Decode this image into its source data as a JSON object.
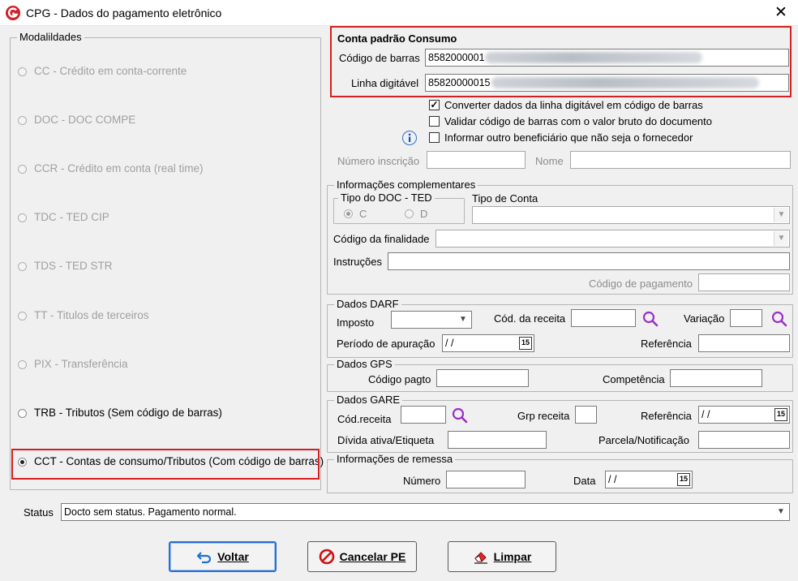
{
  "window": {
    "title": "CPG - Dados do pagamento eletrônico",
    "close_glyph": "✕",
    "logo_icon": "cpg-logo-icon"
  },
  "modalidades": {
    "legend": "Modalildades",
    "items": [
      {
        "label": "CC  - Crédito em conta-corrente",
        "enabled": false,
        "selected": false
      },
      {
        "label": "DOC - DOC COMPE",
        "enabled": false,
        "selected": false
      },
      {
        "label": "CCR - Crédito em conta (real time)",
        "enabled": false,
        "selected": false
      },
      {
        "label": "TDC - TED CIP",
        "enabled": false,
        "selected": false
      },
      {
        "label": "TDS - TED STR",
        "enabled": false,
        "selected": false
      },
      {
        "label": "TT  - Titulos de terceiros",
        "enabled": false,
        "selected": false
      },
      {
        "label": "PIX - Transferência",
        "enabled": false,
        "selected": false
      },
      {
        "label": "TRB - Tributos (Sem código de barras)",
        "enabled": true,
        "selected": false
      },
      {
        "label": "CCT - Contas de consumo/Tributos (Com código de barras)",
        "enabled": true,
        "selected": true
      }
    ]
  },
  "conta_padrao": {
    "legend": "Conta padrão Consumo",
    "codigo_barras_label": "Código de barras",
    "codigo_barras_value": "8582000001",
    "linha_digitavel_label": "Linha digitável",
    "linha_digitavel_value": "85820000015"
  },
  "options": {
    "converter": {
      "label": "Converter dados da linha digitável em código de barras",
      "checked": true
    },
    "validar": {
      "label": "Validar código de barras com o valor bruto do documento",
      "checked": false
    },
    "informar": {
      "label": "Informar outro beneficiário que não seja o fornecedor",
      "checked": false
    },
    "check_glyph": "✓",
    "info_icon": "info-icon"
  },
  "beneficiario": {
    "numero_inscricao_label": "Número inscrição",
    "nome_label": "Nome"
  },
  "info_compl": {
    "legend": "Informações complementares",
    "tipo_doc_legend": "Tipo do DOC - TED",
    "tipo_c": "C",
    "tipo_d": "D",
    "tipo_conta_label": "Tipo de Conta",
    "finalidade_label": "Código da finalidade",
    "instrucoes_label": "Instruções",
    "codigo_pagamento_label": "Código de pagamento"
  },
  "darf": {
    "legend": "Dados DARF",
    "imposto_label": "Imposto",
    "cod_receita_label": "Cód. da receita",
    "variacao_label": "Variação",
    "periodo_label": "Período de apuração",
    "periodo_value": " /  /",
    "referencia_label": "Referência"
  },
  "gps": {
    "legend": "Dados GPS",
    "codigo_label": "Código pagto",
    "competencia_label": "Competência"
  },
  "gare": {
    "legend": "Dados GARE",
    "cod_receita_label": "Cód.receita",
    "grp_receita_label": "Grp receita",
    "referencia_label": "Referência",
    "referencia_value": " /  /",
    "divida_label": "Dívida ativa/Etiqueta",
    "parcela_label": "Parcela/Notificação"
  },
  "remessa": {
    "legend": "Informações de remessa",
    "numero_label": "Número",
    "data_label": "Data",
    "data_value": " /  /"
  },
  "status": {
    "label": "Status",
    "value": "Docto sem status. Pagamento normal."
  },
  "buttons": {
    "voltar": "Voltar",
    "cancelar": "Cancelar PE",
    "limpar": "Limpar"
  },
  "glyphs": {
    "combo_arrow": "▼",
    "calendar": "15"
  },
  "colors": {
    "highlight_red": "#d42020",
    "magnifier_purple": "#9b30c8",
    "logo_red": "#d0202a"
  }
}
